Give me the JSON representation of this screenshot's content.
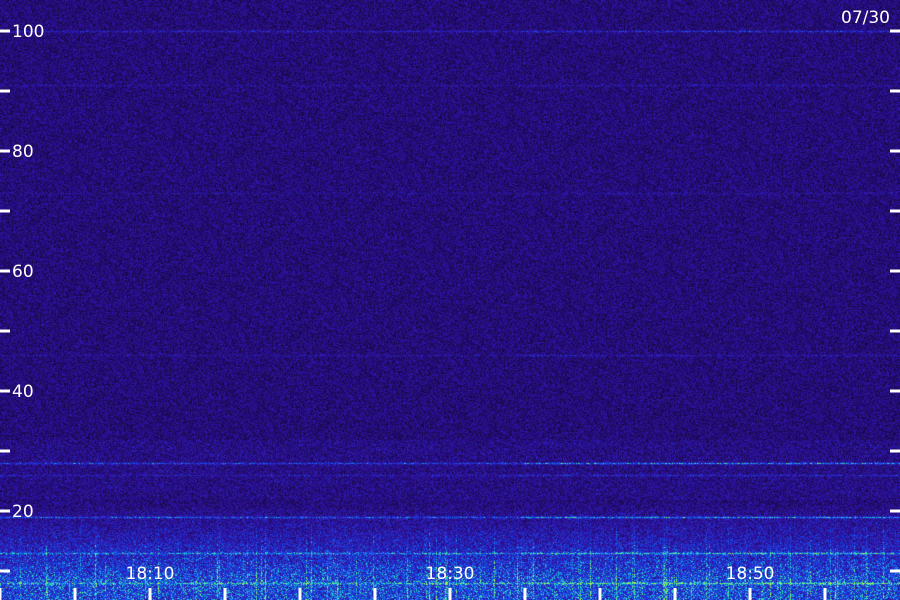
{
  "chart_data": {
    "type": "heatmap",
    "title": "",
    "xlabel": "",
    "ylabel": "",
    "date_label": "07/30",
    "xlim": [
      "18:00",
      "19:00"
    ],
    "ylim": [
      0,
      105
    ],
    "x_ticks": [
      {
        "value": "18:10",
        "label": "18:10"
      },
      {
        "value": "18:30",
        "label": "18:30"
      },
      {
        "value": "18:50",
        "label": "18:50"
      }
    ],
    "x_minor_ticks": [
      "18:00",
      "18:05",
      "18:10",
      "18:15",
      "18:20",
      "18:25",
      "18:30",
      "18:35",
      "18:40",
      "18:45",
      "18:50",
      "18:55"
    ],
    "y_ticks": [
      {
        "value": 20,
        "label": "20"
      },
      {
        "value": 40,
        "label": "40"
      },
      {
        "value": 60,
        "label": "60"
      },
      {
        "value": 80,
        "label": "80"
      },
      {
        "value": 100,
        "label": "100"
      }
    ],
    "y_minor_ticks": [
      0,
      10,
      30,
      50,
      70,
      90
    ],
    "horizontal_lines": [
      {
        "y": 100,
        "intensity": 0.55
      },
      {
        "y": 91,
        "intensity": 0.25
      },
      {
        "y": 73,
        "intensity": 0.2
      },
      {
        "y": 46,
        "intensity": 0.3
      },
      {
        "y": 28,
        "intensity": 0.9
      },
      {
        "y": 26,
        "intensity": 0.4
      },
      {
        "y": 19,
        "intensity": 0.9
      },
      {
        "y": 13,
        "intensity": 0.7
      },
      {
        "y": 8,
        "intensity": 0.6
      },
      {
        "y": 3,
        "intensity": 0.5
      }
    ],
    "low_frequency_band": [
      0,
      22
    ],
    "colorscale": [
      "#1a0a3a",
      "#2a10a0",
      "#1030e0",
      "#10a0e0",
      "#30e0a0",
      "#a0ff40"
    ],
    "grid": false
  }
}
